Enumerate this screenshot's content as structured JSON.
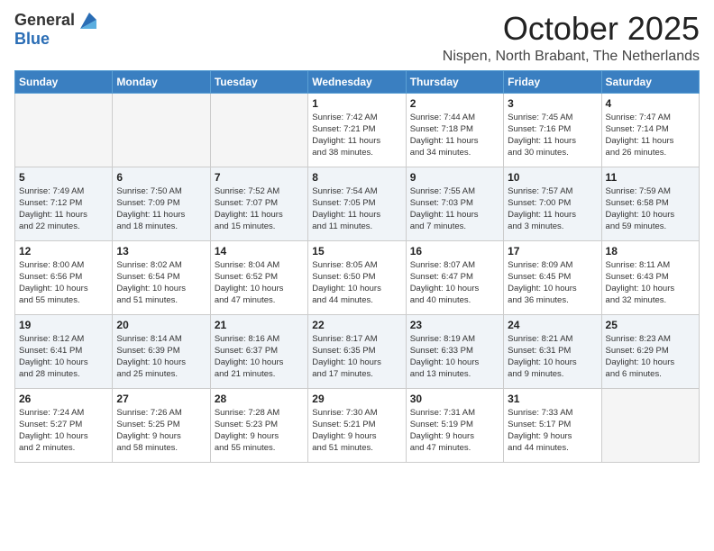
{
  "logo": {
    "general": "General",
    "blue": "Blue"
  },
  "title": {
    "month": "October 2025",
    "location": "Nispen, North Brabant, The Netherlands"
  },
  "weekdays": [
    "Sunday",
    "Monday",
    "Tuesday",
    "Wednesday",
    "Thursday",
    "Friday",
    "Saturday"
  ],
  "weeks": [
    [
      {
        "day": "",
        "info": ""
      },
      {
        "day": "",
        "info": ""
      },
      {
        "day": "",
        "info": ""
      },
      {
        "day": "1",
        "info": "Sunrise: 7:42 AM\nSunset: 7:21 PM\nDaylight: 11 hours\nand 38 minutes."
      },
      {
        "day": "2",
        "info": "Sunrise: 7:44 AM\nSunset: 7:18 PM\nDaylight: 11 hours\nand 34 minutes."
      },
      {
        "day": "3",
        "info": "Sunrise: 7:45 AM\nSunset: 7:16 PM\nDaylight: 11 hours\nand 30 minutes."
      },
      {
        "day": "4",
        "info": "Sunrise: 7:47 AM\nSunset: 7:14 PM\nDaylight: 11 hours\nand 26 minutes."
      }
    ],
    [
      {
        "day": "5",
        "info": "Sunrise: 7:49 AM\nSunset: 7:12 PM\nDaylight: 11 hours\nand 22 minutes."
      },
      {
        "day": "6",
        "info": "Sunrise: 7:50 AM\nSunset: 7:09 PM\nDaylight: 11 hours\nand 18 minutes."
      },
      {
        "day": "7",
        "info": "Sunrise: 7:52 AM\nSunset: 7:07 PM\nDaylight: 11 hours\nand 15 minutes."
      },
      {
        "day": "8",
        "info": "Sunrise: 7:54 AM\nSunset: 7:05 PM\nDaylight: 11 hours\nand 11 minutes."
      },
      {
        "day": "9",
        "info": "Sunrise: 7:55 AM\nSunset: 7:03 PM\nDaylight: 11 hours\nand 7 minutes."
      },
      {
        "day": "10",
        "info": "Sunrise: 7:57 AM\nSunset: 7:00 PM\nDaylight: 11 hours\nand 3 minutes."
      },
      {
        "day": "11",
        "info": "Sunrise: 7:59 AM\nSunset: 6:58 PM\nDaylight: 10 hours\nand 59 minutes."
      }
    ],
    [
      {
        "day": "12",
        "info": "Sunrise: 8:00 AM\nSunset: 6:56 PM\nDaylight: 10 hours\nand 55 minutes."
      },
      {
        "day": "13",
        "info": "Sunrise: 8:02 AM\nSunset: 6:54 PM\nDaylight: 10 hours\nand 51 minutes."
      },
      {
        "day": "14",
        "info": "Sunrise: 8:04 AM\nSunset: 6:52 PM\nDaylight: 10 hours\nand 47 minutes."
      },
      {
        "day": "15",
        "info": "Sunrise: 8:05 AM\nSunset: 6:50 PM\nDaylight: 10 hours\nand 44 minutes."
      },
      {
        "day": "16",
        "info": "Sunrise: 8:07 AM\nSunset: 6:47 PM\nDaylight: 10 hours\nand 40 minutes."
      },
      {
        "day": "17",
        "info": "Sunrise: 8:09 AM\nSunset: 6:45 PM\nDaylight: 10 hours\nand 36 minutes."
      },
      {
        "day": "18",
        "info": "Sunrise: 8:11 AM\nSunset: 6:43 PM\nDaylight: 10 hours\nand 32 minutes."
      }
    ],
    [
      {
        "day": "19",
        "info": "Sunrise: 8:12 AM\nSunset: 6:41 PM\nDaylight: 10 hours\nand 28 minutes."
      },
      {
        "day": "20",
        "info": "Sunrise: 8:14 AM\nSunset: 6:39 PM\nDaylight: 10 hours\nand 25 minutes."
      },
      {
        "day": "21",
        "info": "Sunrise: 8:16 AM\nSunset: 6:37 PM\nDaylight: 10 hours\nand 21 minutes."
      },
      {
        "day": "22",
        "info": "Sunrise: 8:17 AM\nSunset: 6:35 PM\nDaylight: 10 hours\nand 17 minutes."
      },
      {
        "day": "23",
        "info": "Sunrise: 8:19 AM\nSunset: 6:33 PM\nDaylight: 10 hours\nand 13 minutes."
      },
      {
        "day": "24",
        "info": "Sunrise: 8:21 AM\nSunset: 6:31 PM\nDaylight: 10 hours\nand 9 minutes."
      },
      {
        "day": "25",
        "info": "Sunrise: 8:23 AM\nSunset: 6:29 PM\nDaylight: 10 hours\nand 6 minutes."
      }
    ],
    [
      {
        "day": "26",
        "info": "Sunrise: 7:24 AM\nSunset: 5:27 PM\nDaylight: 10 hours\nand 2 minutes."
      },
      {
        "day": "27",
        "info": "Sunrise: 7:26 AM\nSunset: 5:25 PM\nDaylight: 9 hours\nand 58 minutes."
      },
      {
        "day": "28",
        "info": "Sunrise: 7:28 AM\nSunset: 5:23 PM\nDaylight: 9 hours\nand 55 minutes."
      },
      {
        "day": "29",
        "info": "Sunrise: 7:30 AM\nSunset: 5:21 PM\nDaylight: 9 hours\nand 51 minutes."
      },
      {
        "day": "30",
        "info": "Sunrise: 7:31 AM\nSunset: 5:19 PM\nDaylight: 9 hours\nand 47 minutes."
      },
      {
        "day": "31",
        "info": "Sunrise: 7:33 AM\nSunset: 5:17 PM\nDaylight: 9 hours\nand 44 minutes."
      },
      {
        "day": "",
        "info": ""
      }
    ]
  ]
}
